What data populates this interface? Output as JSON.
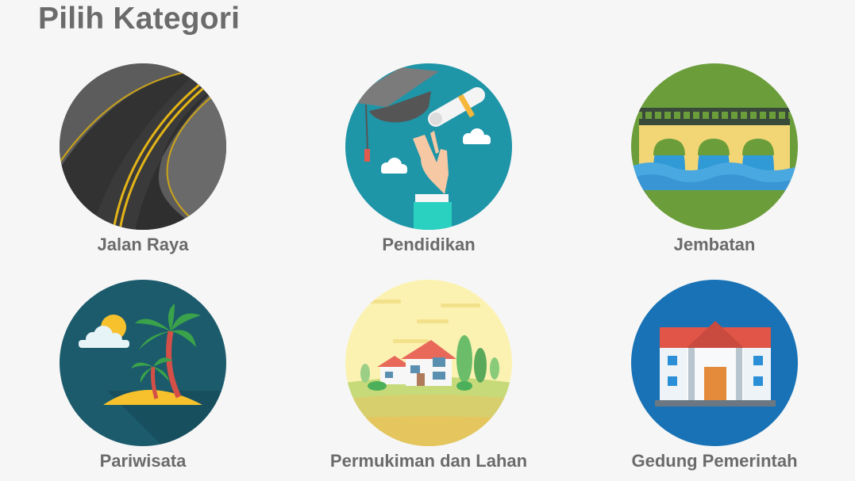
{
  "page": {
    "title": "Pilih Kategori"
  },
  "categories": [
    {
      "label": "Jalan Raya",
      "icon": "road-icon",
      "bg": "#5f5f5f"
    },
    {
      "label": "Pendidikan",
      "icon": "graduation-icon",
      "bg": "#1f95a8"
    },
    {
      "label": "Jembatan",
      "icon": "bridge-icon",
      "bg": "#6b9e3a"
    },
    {
      "label": "Pariwisata",
      "icon": "palm-island-icon",
      "bg": "#1b5b6c"
    },
    {
      "label": "Permukiman dan Lahan",
      "icon": "house-landscape-icon",
      "bg": "#fbf2b2"
    },
    {
      "label": "Gedung Pemerintah",
      "icon": "government-building-icon",
      "bg": "#1872b5"
    }
  ]
}
